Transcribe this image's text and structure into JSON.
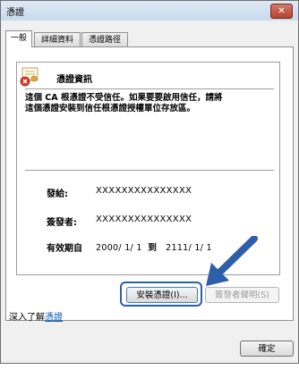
{
  "window": {
    "title": "憑證",
    "close_glyph": "✕"
  },
  "tabs": [
    {
      "label": "一般",
      "active": true
    },
    {
      "label": "詳細資料",
      "active": false
    },
    {
      "label": "憑證路徑",
      "active": false
    }
  ],
  "certificate": {
    "header": "憑證資訊",
    "warning": "這個 CA 根憑證不受信任。如果要要啟用信任，請將\n這個憑證安裝到信任根憑證授權單位存放區。",
    "issued_to_label": "發給:",
    "issued_to_value": "XXXXXXXXXXXXXXX",
    "issued_by_label": "簽發者:",
    "issued_by_value": "XXXXXXXXXXXXXXX",
    "valid_label": "有效期自",
    "valid_from": "2000/ 1/ 1",
    "valid_to_word": "到",
    "valid_to": "2111/ 1/ 1"
  },
  "buttons": {
    "install": "安裝憑證(I)...",
    "issuer_statement": "簽發者聲明(S)",
    "ok": "確定"
  },
  "learn_more": {
    "prefix": "深入了解",
    "link": "憑證"
  },
  "colors": {
    "highlight": "#2d5fa8",
    "arrow": "#2d5fa8",
    "link": "#0b5bb5"
  }
}
